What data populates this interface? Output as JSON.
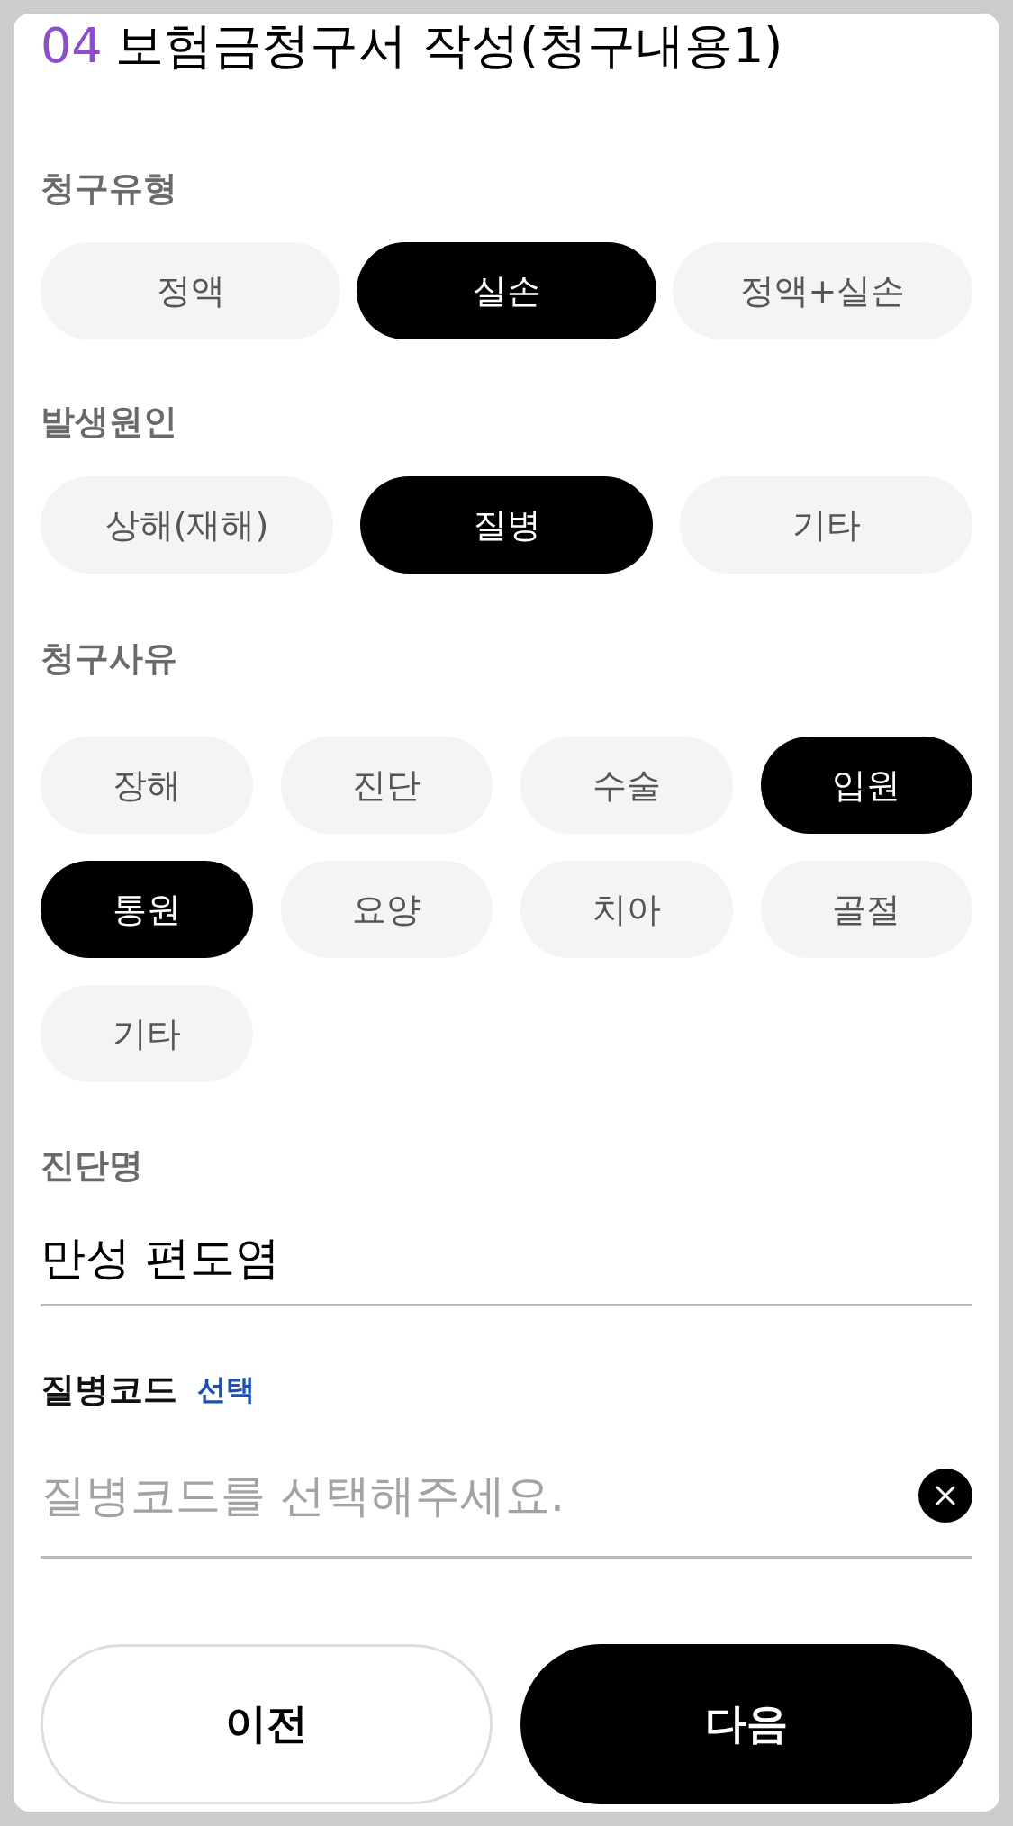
{
  "title": {
    "step": "04",
    "text": "보험금청구서 작성(청구내용1)"
  },
  "groups": [
    {
      "label": "청구유형",
      "options": [
        {
          "label": "정액",
          "selected": false
        },
        {
          "label": "실손",
          "selected": true
        },
        {
          "label": "정액+실손",
          "selected": false
        }
      ]
    },
    {
      "label": "발생원인",
      "options": [
        {
          "label": "상해(재해)",
          "selected": false
        },
        {
          "label": "질병",
          "selected": true
        },
        {
          "label": "기타",
          "selected": false
        }
      ]
    },
    {
      "label": "청구사유",
      "options": [
        {
          "label": "장해",
          "selected": false
        },
        {
          "label": "진단",
          "selected": false
        },
        {
          "label": "수술",
          "selected": false
        },
        {
          "label": "입원",
          "selected": true
        },
        {
          "label": "통원",
          "selected": true
        },
        {
          "label": "요양",
          "selected": false
        },
        {
          "label": "치아",
          "selected": false
        },
        {
          "label": "골절",
          "selected": false
        },
        {
          "label": "기타",
          "selected": false
        }
      ]
    }
  ],
  "diagnosis": {
    "label": "진단명",
    "value": "만성 편도염"
  },
  "disease_code": {
    "label": "질병코드",
    "action": "선택",
    "placeholder": "질병코드를 선택해주세요."
  },
  "buttons": [
    {
      "label": "이전",
      "kind": "secondary"
    },
    {
      "label": "다음",
      "kind": "primary"
    }
  ]
}
